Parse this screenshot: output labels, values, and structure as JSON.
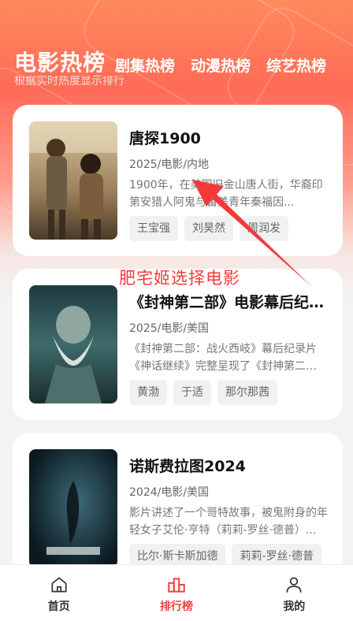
{
  "top_tabs": [
    {
      "label": "电影热榜",
      "active": true
    },
    {
      "label": "剧集热榜",
      "active": false
    },
    {
      "label": "动漫热榜",
      "active": false
    },
    {
      "label": "综艺热榜",
      "active": false
    }
  ],
  "subtitle": "根据实时热度显示排行",
  "cards": [
    {
      "title": "唐探1900",
      "meta": "2025/电影/内地",
      "desc": "1900年，在美国旧金山唐人街，华裔印第安猎人阿鬼与留美青年秦福因...",
      "cast": [
        "王宝强",
        "刘昊然",
        "周润发"
      ]
    },
    {
      "title": "《封神第二部》电影幕后纪录片",
      "meta": "2025/电影/美国",
      "desc": "《封神第二部：战火西岐》幕后纪录片《神话继续》完整呈现了《封神第二部》...",
      "cast": [
        "黄渤",
        "于适",
        "那尔那茜"
      ]
    },
    {
      "title": "诺斯费拉图2024",
      "meta": "2024/电影/美国",
      "desc": "影片讲述了一个哥特故事，被鬼附身的年轻女子艾伦·亨特（莉莉-罗丝·德普）...",
      "cast": [
        "比尔·斯卡斯加德",
        "莉莉-罗丝·德普"
      ]
    }
  ],
  "annotation": "肥宅姬选择电影",
  "annotation_color": "#f23a3a",
  "accent": "#f04040",
  "bottom_nav": [
    {
      "label": "首页",
      "icon": "home-icon",
      "active": false
    },
    {
      "label": "排行榜",
      "icon": "ranking-icon",
      "active": true
    },
    {
      "label": "我的",
      "icon": "user-icon",
      "active": false
    }
  ]
}
